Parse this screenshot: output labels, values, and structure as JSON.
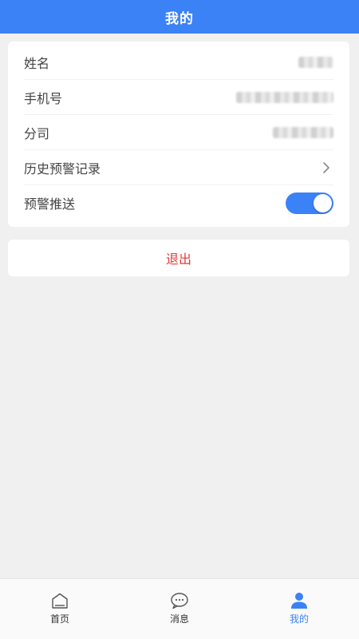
{
  "header": {
    "title": "我的"
  },
  "profile": {
    "rows": [
      {
        "label": "姓名",
        "value": ""
      },
      {
        "label": "手机号",
        "value": ""
      },
      {
        "label": "分司",
        "value": ""
      },
      {
        "label": "历史预警记录",
        "icon": "chevron-right-icon"
      },
      {
        "label": "预警推送",
        "toggle_on": true
      }
    ]
  },
  "logout": {
    "label": "退出"
  },
  "tabbar": {
    "tabs": [
      {
        "label": "首页",
        "icon": "home-icon",
        "active": false
      },
      {
        "label": "消息",
        "icon": "message-icon",
        "active": false
      },
      {
        "label": "我的",
        "icon": "user-icon",
        "active": true
      }
    ]
  },
  "colors": {
    "accent": "#3b82f6",
    "danger": "#e53935",
    "background": "#f0f0f0"
  }
}
